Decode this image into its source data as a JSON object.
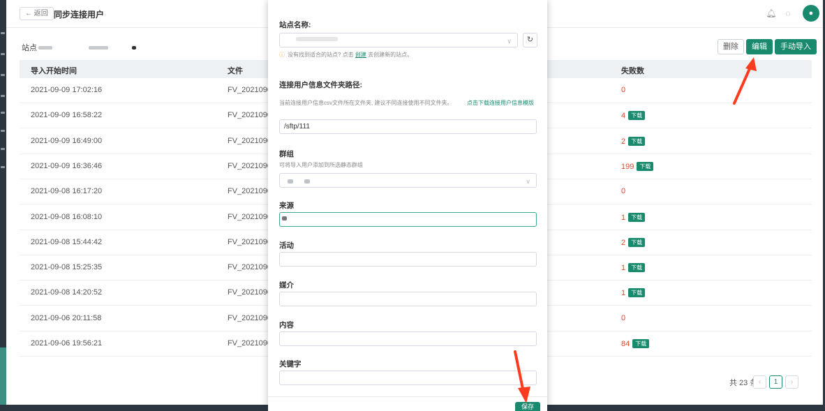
{
  "header": {
    "back_label": "← 返回",
    "title": "同步连接用户",
    "bell_icon": "bell-icon",
    "chat_icon": "chat-icon",
    "avatar_icon": "user-icon"
  },
  "toolbar": {
    "site_label": "站点",
    "delete_label": "删除",
    "edit_label": "编辑",
    "import_label": "手动导入"
  },
  "table": {
    "columns": [
      "导入开始时间",
      "文件",
      "失败数"
    ],
    "rows": [
      {
        "time": "2021-09-09 17:02:16",
        "file": "FV_2021090",
        "fail": "0",
        "download": ""
      },
      {
        "time": "2021-09-09 16:58:22",
        "file": "FV_2021090",
        "fail": "4",
        "download": "下载"
      },
      {
        "time": "2021-09-09 16:49:00",
        "file": "FV_2021090",
        "fail": "2",
        "download": "下载"
      },
      {
        "time": "2021-09-09 16:36:46",
        "file": "FV_2021090",
        "fail": "199",
        "download": "下载"
      },
      {
        "time": "2021-09-08 16:17:20",
        "file": "FV_2021090",
        "fail": "0",
        "download": ""
      },
      {
        "time": "2021-09-08 16:08:10",
        "file": "FV_2021090",
        "fail": "1",
        "download": "下载"
      },
      {
        "time": "2021-09-08 15:44:42",
        "file": "FV_2021090",
        "fail": "2",
        "download": "下载"
      },
      {
        "time": "2021-09-08 15:25:35",
        "file": "FV_2021090",
        "fail": "1",
        "download": "下载"
      },
      {
        "time": "2021-09-08 14:20:52",
        "file": "FV_2021090",
        "fail": "1",
        "download": "下载"
      },
      {
        "time": "2021-09-06 20:11:58",
        "file": "FV_2021090",
        "fail": "0",
        "download": ""
      },
      {
        "time": "2021-09-06 19:56:21",
        "file": "FV_2021090",
        "fail": "84",
        "download": "下载"
      }
    ]
  },
  "pagination": {
    "total_label": "共 23 条",
    "prev": "‹",
    "current": "1",
    "next": "›"
  },
  "modal": {
    "site_name_label": "站点名称:",
    "site_name_value": "",
    "warn_text_1": "没有找到适合的站点? 点击",
    "warn_link": "创建",
    "warn_text_2": "去创建新的站点。",
    "path_label": "连接用户信息文件夹路径:",
    "path_hint": "当前连接用户信息csv文件所在文件夹, 建议不同连接使用不同文件夹。",
    "path_template_link": "点击下载连接用户信息模版",
    "path_value": "/sftp/111",
    "group_label": "群组",
    "group_hint": "可将导入用户添加到所选静态群组",
    "source_label": "来源",
    "activity_label": "活动",
    "media_label": "媒介",
    "content_label": "内容",
    "keyword_label": "关键字",
    "save_label": "保存"
  },
  "colors": {
    "accent": "#1a8a6e",
    "danger": "#e0452e",
    "annotation": "#ff3b1f"
  }
}
